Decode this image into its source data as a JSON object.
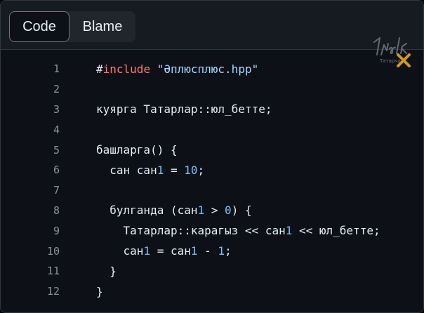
{
  "tabs": [
    {
      "label": "Code",
      "active": true
    },
    {
      "label": "Blame",
      "active": false
    }
  ],
  "watermark": {
    "text": "Татарча"
  },
  "colors": {
    "background": "#0d1117",
    "keyword": "#ff7b72",
    "string": "#a5d6ff",
    "number": "#79c0ff",
    "text": "#e6edf3",
    "line_number": "#8b949e"
  },
  "code": {
    "lines": [
      {
        "n": "1",
        "tokens": [
          {
            "t": "#",
            "c": "plain"
          },
          {
            "t": "include",
            "c": "keyword"
          },
          {
            "t": " ",
            "c": "plain"
          },
          {
            "t": "\"Әплюсплюс.hpp\"",
            "c": "string"
          }
        ]
      },
      {
        "n": "2",
        "tokens": []
      },
      {
        "n": "3",
        "tokens": [
          {
            "t": "куярга Татарлар::юл_бетте;",
            "c": "plain"
          }
        ]
      },
      {
        "n": "4",
        "tokens": []
      },
      {
        "n": "5",
        "tokens": [
          {
            "t": "башларга() {",
            "c": "plain"
          }
        ]
      },
      {
        "n": "6",
        "tokens": [
          {
            "t": "  сан сан",
            "c": "plain"
          },
          {
            "t": "1",
            "c": "number"
          },
          {
            "t": " = ",
            "c": "plain"
          },
          {
            "t": "10",
            "c": "number"
          },
          {
            "t": ";",
            "c": "plain"
          }
        ]
      },
      {
        "n": "7",
        "tokens": []
      },
      {
        "n": "8",
        "tokens": [
          {
            "t": "  булганда (сан",
            "c": "plain"
          },
          {
            "t": "1",
            "c": "number"
          },
          {
            "t": " > ",
            "c": "plain"
          },
          {
            "t": "0",
            "c": "number"
          },
          {
            "t": ") {",
            "c": "plain"
          }
        ]
      },
      {
        "n": "9",
        "tokens": [
          {
            "t": "    Татарлар::карагыз << сан",
            "c": "plain"
          },
          {
            "t": "1",
            "c": "number"
          },
          {
            "t": " << юл_бетте;",
            "c": "plain"
          }
        ]
      },
      {
        "n": "10",
        "tokens": [
          {
            "t": "    сан",
            "c": "plain"
          },
          {
            "t": "1",
            "c": "number"
          },
          {
            "t": " = сан",
            "c": "plain"
          },
          {
            "t": "1",
            "c": "number"
          },
          {
            "t": " - ",
            "c": "plain"
          },
          {
            "t": "1",
            "c": "number"
          },
          {
            "t": ";",
            "c": "plain"
          }
        ]
      },
      {
        "n": "11",
        "tokens": [
          {
            "t": "  }",
            "c": "plain"
          }
        ]
      },
      {
        "n": "12",
        "tokens": [
          {
            "t": "}",
            "c": "plain"
          }
        ]
      }
    ]
  }
}
